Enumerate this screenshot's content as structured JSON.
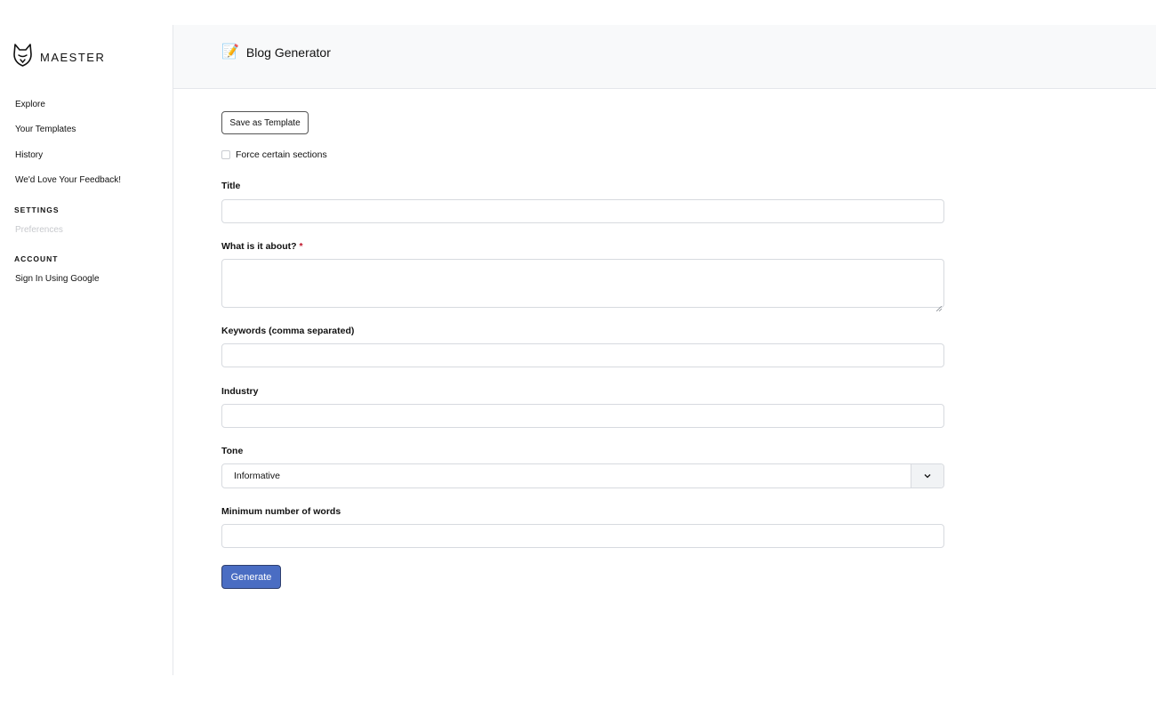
{
  "brand": {
    "name": "MAESTER",
    "logo_icon": "fox-head-icon"
  },
  "sidebar": {
    "items": [
      {
        "label": "Explore"
      },
      {
        "label": "Your Templates"
      },
      {
        "label": "History"
      },
      {
        "label": "We'd Love Your Feedback!"
      }
    ],
    "settings_heading": "SETTINGS",
    "settings_items": [
      {
        "label": "Preferences",
        "disabled": true
      }
    ],
    "account_heading": "ACCOUNT",
    "account_items": [
      {
        "label": "Sign In Using Google"
      }
    ]
  },
  "header": {
    "icon": "memo-icon",
    "emoji": "📝",
    "title": "Blog Generator"
  },
  "form": {
    "save_template_label": "Save as Template",
    "force_sections_label": "Force certain sections",
    "force_sections_checked": false,
    "fields": {
      "title": {
        "label": "Title",
        "value": ""
      },
      "about": {
        "label": "What is it about?",
        "required_mark": "*",
        "value": ""
      },
      "keywords": {
        "label": "Keywords (comma separated)",
        "value": ""
      },
      "industry": {
        "label": "Industry",
        "value": ""
      },
      "tone": {
        "label": "Tone",
        "value": "Informative"
      },
      "min_words": {
        "label": "Minimum number of words",
        "value": ""
      }
    },
    "generate_label": "Generate"
  },
  "colors": {
    "primary": "#4a6dc3",
    "required": "#c0182c",
    "header_bg": "#f8f9fa"
  }
}
